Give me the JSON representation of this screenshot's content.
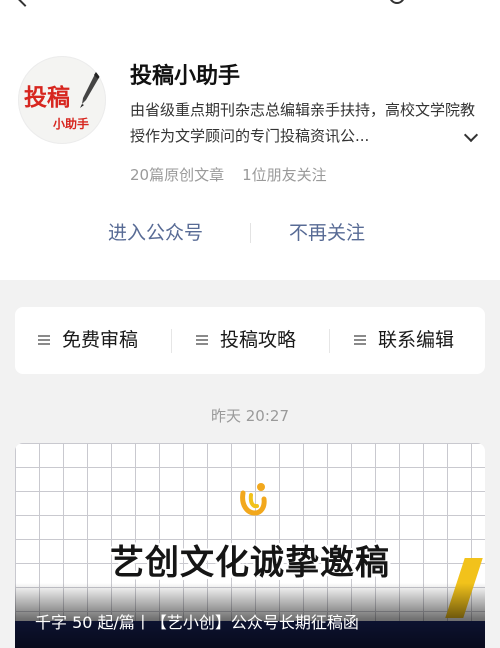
{
  "account": {
    "name": "投稿小助手",
    "avatar": {
      "logo_main": "投稿",
      "logo_sub": "小助手"
    },
    "description": "由省级重点期刊杂志总编辑亲手扶持，高校文学院教授作为文学顾问的专门投稿资讯公...",
    "stats": {
      "articles": "20篇原创文章",
      "friends_following": "1位朋友关注"
    },
    "actions": {
      "enter": "进入公众号",
      "unfollow": "不再关注"
    }
  },
  "menu": {
    "items": [
      {
        "label": "免费审稿"
      },
      {
        "label": "投稿攻略"
      },
      {
        "label": "联系编辑"
      }
    ]
  },
  "timeline": {
    "timestamp": "昨天 20:27"
  },
  "article": {
    "banner_text": "艺创文化诚挚邀稿",
    "caption": "千字 50 起/篇丨【艺小创】公众号长期征稿函"
  },
  "colors": {
    "link_blue": "#586b95",
    "logo_red": "#d7261f",
    "muted_gray": "#9a9a9a",
    "accent_yellow": "#f2c21b",
    "banner_navy": "#1d2a6e"
  },
  "icons": {
    "back": "back-arrow-icon",
    "search": "search-icon",
    "expand": "chevron-down-icon",
    "menu": "hamburger-icon",
    "article_logo": "yichuang-logo-icon"
  }
}
